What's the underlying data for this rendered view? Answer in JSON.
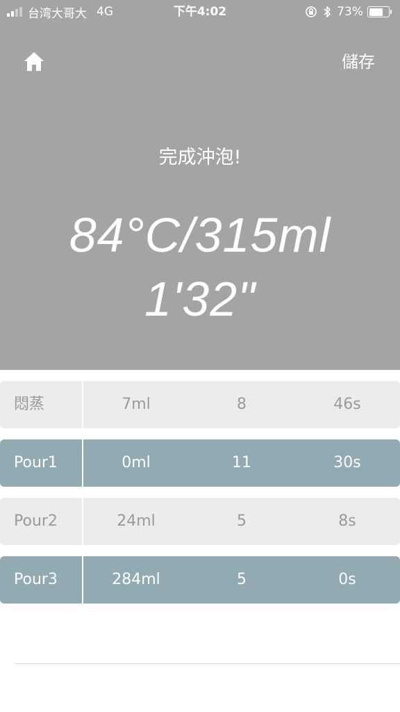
{
  "status_bar": {
    "carrier": "台湾大哥大",
    "network": "4G",
    "time": "下午4:02",
    "battery": "73%",
    "battery_level": 0.73
  },
  "header": {
    "save_label": "儲存",
    "done_label": "完成沖泡!",
    "summary_line1": "84°C/315ml",
    "summary_line2": "1'32\""
  },
  "steps": [
    {
      "name": "悶蒸",
      "volume": "7ml",
      "count": "8",
      "time": "46s",
      "style": "light"
    },
    {
      "name": "Pour1",
      "volume": "0ml",
      "count": "11",
      "time": "30s",
      "style": "dark"
    },
    {
      "name": "Pour2",
      "volume": "24ml",
      "count": "5",
      "time": "8s",
      "style": "light"
    },
    {
      "name": "Pour3",
      "volume": "284ml",
      "count": "5",
      "time": "0s",
      "style": "dark"
    }
  ],
  "colors": {
    "header_bg": "#a4a4a4",
    "row_light": "#ececec",
    "row_dark": "#92aab1"
  }
}
